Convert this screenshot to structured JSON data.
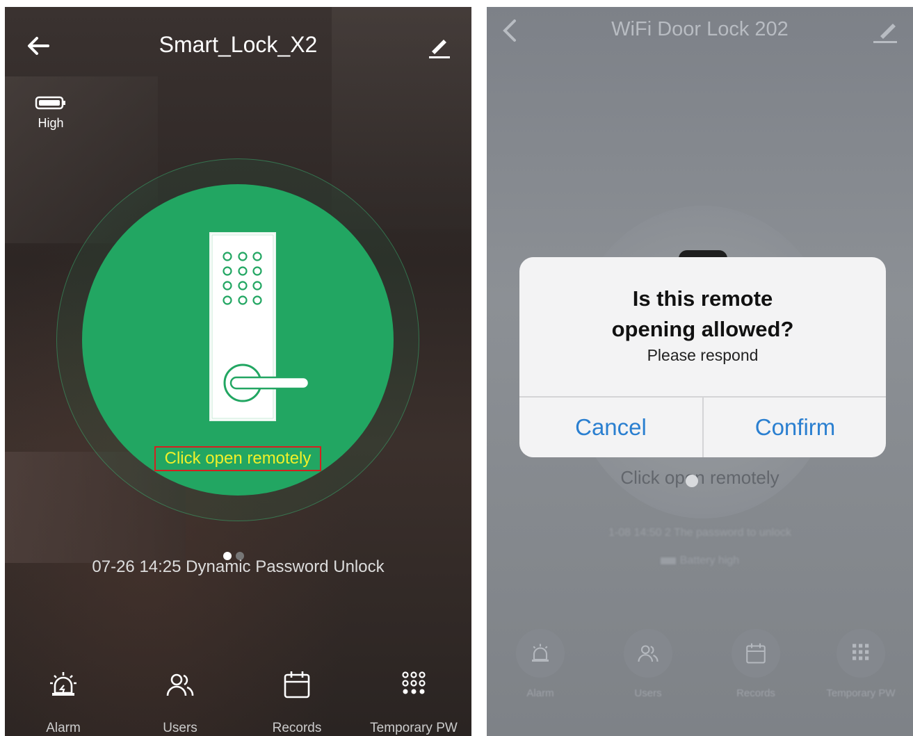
{
  "left_screen": {
    "title": "Smart_Lock_X2",
    "battery_label": "High",
    "remote_open_label": "Click open remotely",
    "last_record": "07-26 14:25  Dynamic Password Unlock",
    "nav": [
      {
        "label": "Alarm",
        "icon": "alarm-icon"
      },
      {
        "label": "Users",
        "icon": "users-icon"
      },
      {
        "label": "Records",
        "icon": "calendar-icon"
      },
      {
        "label": "Temporary PW",
        "icon": "keypad-icon"
      }
    ],
    "colors": {
      "accent_green": "#22a662",
      "highlight_text": "#f0f02a",
      "highlight_border": "#d42020"
    }
  },
  "right_screen": {
    "title": "WiFi Door Lock 202",
    "remote_open_label": "Click open remotely",
    "record_text": "1-08 14:50 2 The password to unlock",
    "battery_text": "Battery high",
    "nav": [
      {
        "label": "Alarm",
        "icon": "alarm-icon"
      },
      {
        "label": "Users",
        "icon": "users-icon"
      },
      {
        "label": "Records",
        "icon": "calendar-icon"
      },
      {
        "label": "Temporary PW",
        "icon": "keypad-icon"
      }
    ],
    "dialog": {
      "title_line1": "Is this remote",
      "title_line2": "opening allowed?",
      "subtitle": "Please respond",
      "cancel_label": "Cancel",
      "confirm_label": "Confirm"
    },
    "colors": {
      "button_blue": "#2a7fd0"
    }
  }
}
